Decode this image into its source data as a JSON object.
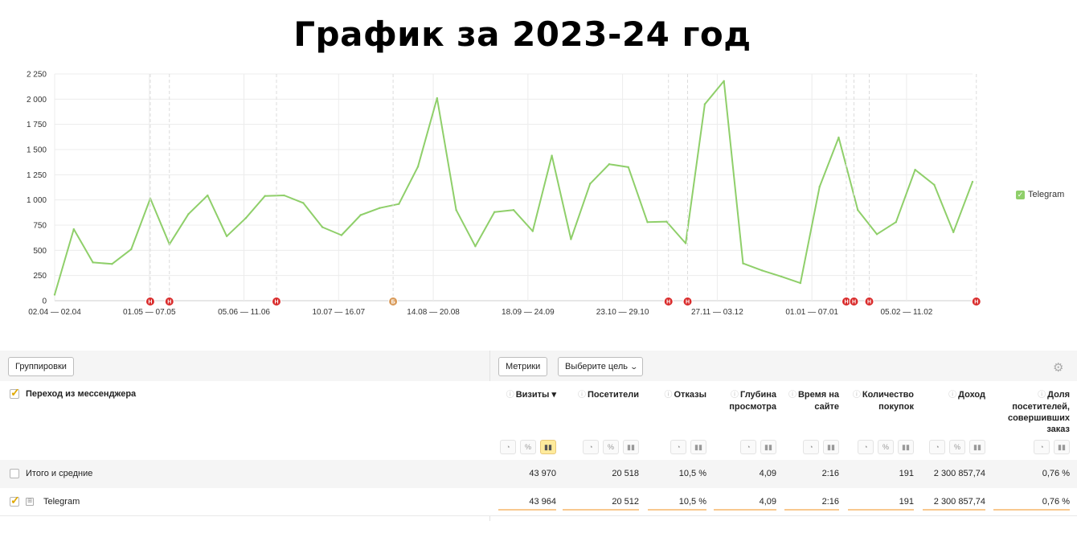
{
  "title": "График за 2023-24 год",
  "colors": {
    "line": "#8fcf6a",
    "marker_red": "#d92b2b",
    "marker_orange": "#d99b5a",
    "bar_under": "#f8c98f"
  },
  "chart_data": {
    "type": "line",
    "series": [
      {
        "name": "Telegram",
        "values": [
          60,
          710,
          380,
          365,
          510,
          1015,
          560,
          860,
          1045,
          640,
          820,
          1040,
          1045,
          970,
          730,
          650,
          850,
          920,
          960,
          1330,
          2010,
          900,
          540,
          880,
          900,
          690,
          1440,
          610,
          1160,
          1355,
          1325,
          780,
          785,
          570,
          1950,
          2180,
          370,
          300,
          240,
          175,
          1130,
          1620,
          900,
          660,
          780,
          1300,
          1150,
          680,
          1180
        ]
      }
    ],
    "x_tick_labels": [
      "02.04 — 02.04",
      "01.05 — 07.05",
      "05.06 — 11.06",
      "10.07 — 16.07",
      "14.08 — 20.08",
      "18.09 — 24.09",
      "23.10 — 29.10",
      "27.11 — 03.12",
      "01.01 — 07.01",
      "05.02 — 11.02"
    ],
    "y_tick_labels": [
      "0",
      "250",
      "500",
      "750",
      "1 000",
      "1 250",
      "1 500",
      "1 750",
      "2 000",
      "2 250"
    ],
    "ylim": [
      0,
      2250
    ],
    "grid": true,
    "legend": "right",
    "markers": [
      {
        "label": "Н",
        "index": 5,
        "color": "red"
      },
      {
        "label": "Н",
        "index": 6,
        "color": "red"
      },
      {
        "label": "Н",
        "index": 11.6,
        "color": "red"
      },
      {
        "label": "Б",
        "index": 17.7,
        "color": "orange"
      },
      {
        "label": "Н",
        "index": 32.1,
        "color": "red"
      },
      {
        "label": "Н",
        "index": 33.1,
        "color": "red"
      },
      {
        "label": "Н",
        "index": 41.4,
        "color": "red"
      },
      {
        "label": "Н",
        "index": 41.8,
        "color": "red"
      },
      {
        "label": "Н",
        "index": 42.6,
        "color": "red"
      },
      {
        "label": "Н",
        "index": 48.2,
        "color": "red"
      }
    ]
  },
  "legend": {
    "label": "Telegram",
    "check": "✓"
  },
  "toolbar": {
    "group_label": "Группировки",
    "metrics_label": "Метрики",
    "goal_label": "Выберите цель",
    "goal_chevron": "⌄",
    "gear": "⚙"
  },
  "table": {
    "dimension_header": "Переход из мессенджера",
    "columns": [
      {
        "label": "Визиты ▾",
        "icons": [
          "◔",
          "%",
          "▮▮"
        ]
      },
      {
        "label": "Посетители",
        "icons": [
          "◔",
          "%",
          "▮▮"
        ]
      },
      {
        "label": "Отказы",
        "icons": [
          "◔",
          "▮▮"
        ]
      },
      {
        "label": "Глубина просмотра",
        "icons": [
          "◔",
          "▮▮"
        ]
      },
      {
        "label": "Время на сайте",
        "icons": [
          "◔",
          "▮▮"
        ]
      },
      {
        "label": "Количество покупок",
        "icons": [
          "◔",
          "%",
          "▮▮"
        ]
      },
      {
        "label": "Доход",
        "icons": [
          "◔",
          "%",
          "▮▮"
        ]
      },
      {
        "label": "Доля посетителей, совершивших заказ",
        "icons": [
          "◔",
          "▮▮"
        ]
      }
    ],
    "rows": [
      {
        "label": "Итого и средние",
        "values": [
          "43 970",
          "20 518",
          "10,5 %",
          "4,09",
          "2:16",
          "191",
          "2 300 857,74",
          "0,76 %"
        ]
      },
      {
        "label": "Telegram",
        "values": [
          "43 964",
          "20 512",
          "10,5 %",
          "4,09",
          "2:16",
          "191",
          "2 300 857,74",
          "0,76 %"
        ]
      }
    ]
  }
}
